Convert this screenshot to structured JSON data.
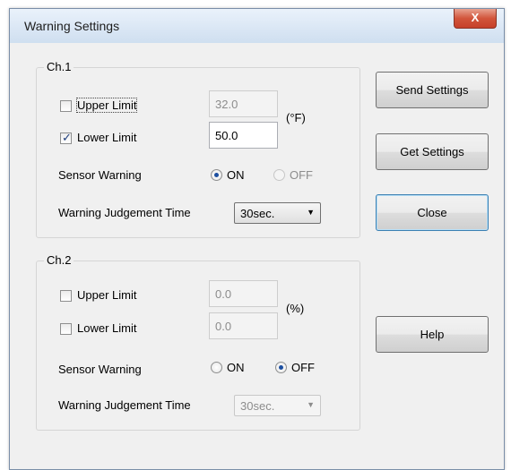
{
  "window": {
    "title": "Warning Settings",
    "close_glyph": "X"
  },
  "ch1": {
    "legend": "Ch.1",
    "upper_label": "Upper Limit",
    "upper_checked": false,
    "upper_value": "32.0",
    "lower_label": "Lower Limit",
    "lower_checked": true,
    "lower_value": "50.0",
    "unit": "(°F)",
    "sensor_label": "Sensor Warning",
    "sensor_on": "ON",
    "sensor_off": "OFF",
    "sensor_selected": "ON",
    "judgement_label": "Warning Judgement Time",
    "judgement_value": "30sec."
  },
  "ch2": {
    "legend": "Ch.2",
    "upper_label": "Upper Limit",
    "upper_checked": false,
    "upper_value": "0.0",
    "lower_label": "Lower Limit",
    "lower_checked": false,
    "lower_value": "0.0",
    "unit": "(%)",
    "sensor_label": "Sensor Warning",
    "sensor_on": "ON",
    "sensor_off": "OFF",
    "sensor_selected": "OFF",
    "judgement_label": "Warning Judgement Time",
    "judgement_value": "30sec."
  },
  "buttons": {
    "send": "Send Settings",
    "get": "Get Settings",
    "close": "Close",
    "help": "Help"
  },
  "icons": {
    "checkmark": "✓",
    "dropdown": "▼"
  }
}
